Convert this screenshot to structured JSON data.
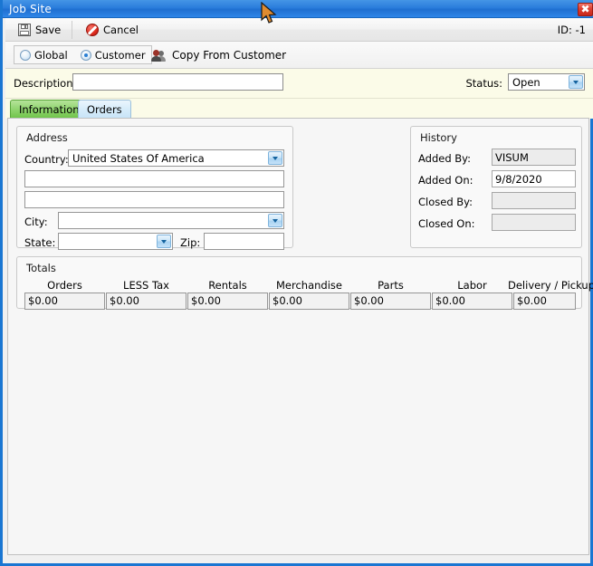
{
  "window": {
    "title": "Job Site",
    "close_icon": "close-icon"
  },
  "toolbar": {
    "save_label": "Save",
    "save_icon": "floppy-disk-icon",
    "cancel_label": "Cancel",
    "cancel_icon": "cancel-circle-icon",
    "id_label": "ID: -1"
  },
  "modebar": {
    "radios": [
      {
        "label": "Global",
        "selected": false
      },
      {
        "label": "Customer",
        "selected": true
      }
    ],
    "copy_label": "Copy From Customer",
    "copy_icon": "people-icon"
  },
  "description": {
    "label": "Description:",
    "value": "",
    "placeholder": ""
  },
  "status": {
    "label": "Status:",
    "value": "Open",
    "dropdown_icon": "chevron-down-icon"
  },
  "tabs": [
    {
      "label": "Information",
      "active": true
    },
    {
      "label": "Orders",
      "active": false
    }
  ],
  "address": {
    "title": "Address",
    "country_label": "Country:",
    "country_value": "United States Of America",
    "line1_value": "",
    "line2_value": "",
    "city_label": "City:",
    "city_value": "",
    "state_label": "State:",
    "state_value": "",
    "zip_label": "Zip:",
    "zip_value": ""
  },
  "history": {
    "title": "History",
    "rows": [
      {
        "label": "Added By:",
        "value": "VISUM"
      },
      {
        "label": "Added On:",
        "value": "9/8/2020"
      },
      {
        "label": "Closed By:",
        "value": ""
      },
      {
        "label": "Closed On:",
        "value": ""
      }
    ]
  },
  "totals": {
    "title": "Totals",
    "columns": [
      {
        "header": "Orders",
        "value": "$0.00"
      },
      {
        "header": "LESS Tax",
        "value": "$0.00"
      },
      {
        "header": "Rentals",
        "value": "$0.00"
      },
      {
        "header": "Merchandise",
        "value": "$0.00"
      },
      {
        "header": "Parts",
        "value": "$0.00"
      },
      {
        "header": "Labor",
        "value": "$0.00"
      },
      {
        "header": "Delivery / Pickup",
        "value": "$0.00"
      }
    ]
  },
  "colors": {
    "titlebar": "#2a7ddc",
    "frame_border": "#1a76d2",
    "active_tab": "#8fd46e",
    "inactive_tab": "#d6ecfa",
    "desc_strip": "#fbfbe8",
    "close_button": "#d8331f"
  }
}
